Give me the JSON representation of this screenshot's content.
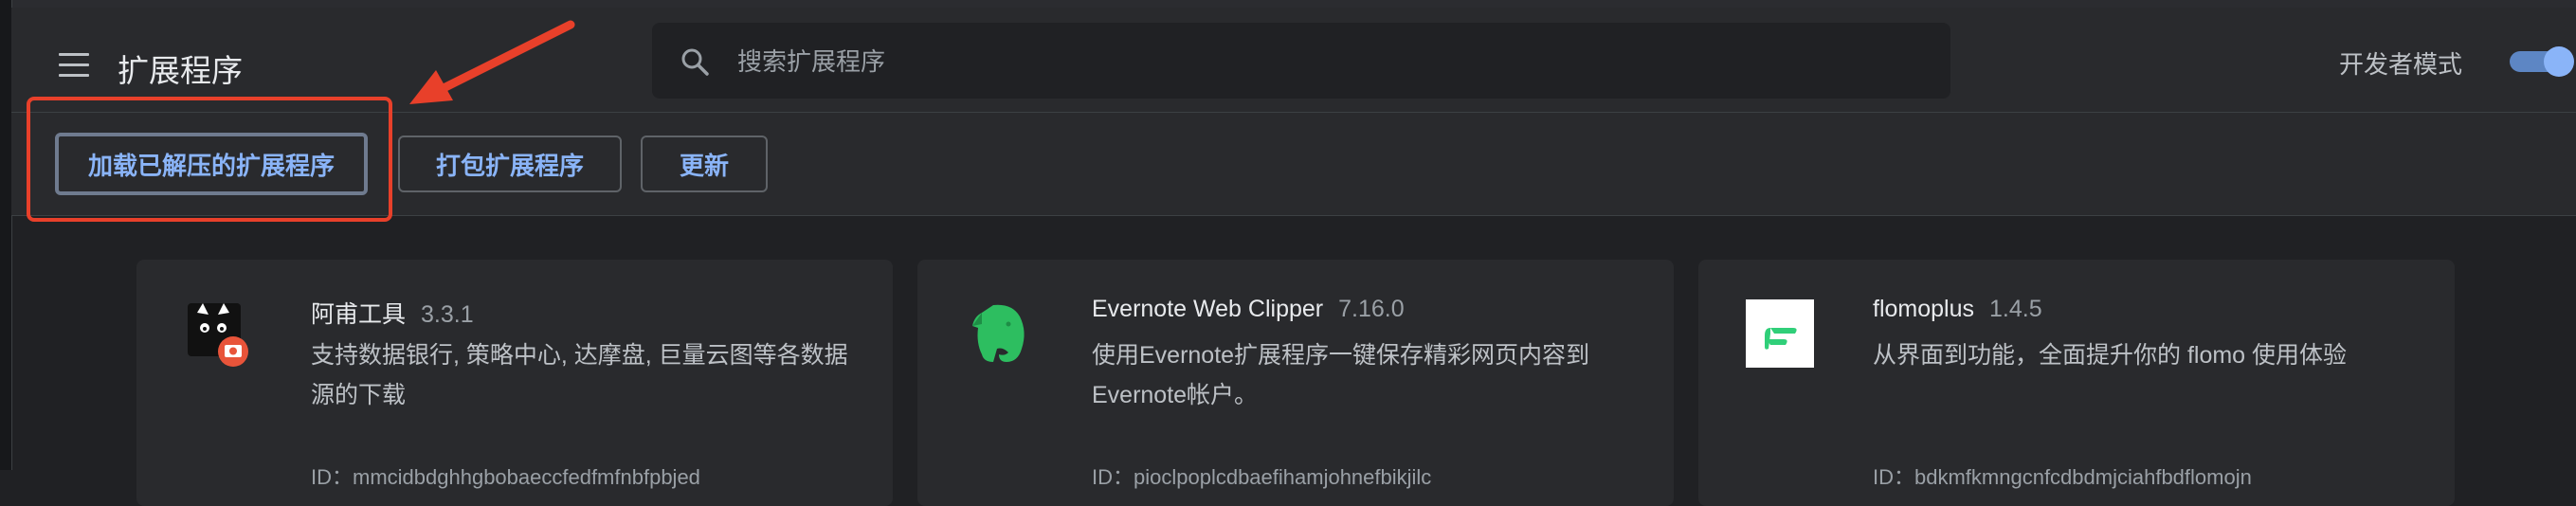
{
  "header": {
    "title": "扩展程序",
    "search_placeholder": "搜索扩展程序",
    "dev_mode_label": "开发者模式",
    "dev_mode_on": true
  },
  "toolbar": {
    "load_unpacked_label": "加载已解压的扩展程序",
    "pack_label": "打包扩展程序",
    "update_label": "更新"
  },
  "annotation": {
    "color": "#e8402a"
  },
  "extensions": [
    {
      "name": "阿甫工具",
      "version": "3.3.1",
      "description": "支持数据银行, 策略中心, 达摩盘, 巨量云图等各数据源的下载",
      "id": "ID：mmcidbdghhgbobaeccfedfmfnbfpbjed",
      "icon": "cat-icon"
    },
    {
      "name": "Evernote Web Clipper",
      "version": "7.16.0",
      "description": "使用Evernote扩展程序一键保存精彩网页内容到Evernote帐户。",
      "id": "ID：pioclpoplcdbaefihamjohnefbikjilc",
      "icon": "evernote-elephant-icon"
    },
    {
      "name": "flomoplus",
      "version": "1.4.5",
      "description": "从界面到功能，全面提升你的 flomo 使用体验",
      "id": "ID：bdkmfkmngcnfcdbdmjciahfbdflomojn",
      "icon": "flomo-icon"
    }
  ]
}
